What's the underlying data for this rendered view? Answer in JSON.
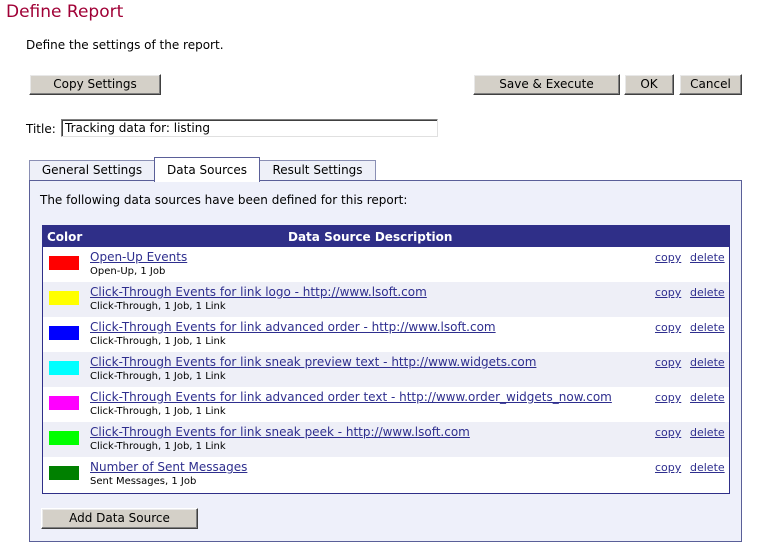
{
  "page": {
    "title": "Define Report",
    "intro": "Define the settings of the report."
  },
  "toolbar": {
    "copy_settings": "Copy Settings",
    "save_execute": "Save & Execute",
    "ok": "OK",
    "cancel": "Cancel"
  },
  "title_field": {
    "label": "Title:",
    "value": "Tracking data for: listing"
  },
  "tabs": [
    {
      "label": "General Settings",
      "active": false
    },
    {
      "label": "Data Sources",
      "active": true
    },
    {
      "label": "Result Settings",
      "active": false
    }
  ],
  "data_sources": {
    "intro": "The following data sources have been defined for this report:",
    "header_color": "Color",
    "header_description": "Data Source Description",
    "copy_label": "copy",
    "delete_label": "delete",
    "add_button": "Add Data Source",
    "rows": [
      {
        "color": "#ff0000",
        "name": "Open-Up Events",
        "detail": "Open-Up, 1 Job"
      },
      {
        "color": "#ffff00",
        "name": "Click-Through Events for link logo - http://www.lsoft.com",
        "detail": "Click-Through, 1 Job, 1 Link"
      },
      {
        "color": "#0000ff",
        "name": "Click-Through Events for link advanced order - http://www.lsoft.com",
        "detail": "Click-Through, 1 Job, 1 Link"
      },
      {
        "color": "#00ffff",
        "name": "Click-Through Events for link sneak preview text - http://www.widgets.com",
        "detail": "Click-Through, 1 Job, 1 Link"
      },
      {
        "color": "#ff00ff",
        "name": "Click-Through Events for link advanced order text - http://www.order_widgets_now.com",
        "detail": "Click-Through, 1 Job, 1 Link"
      },
      {
        "color": "#00ff00",
        "name": "Click-Through Events for link sneak peek - http://www.lsoft.com",
        "detail": "Click-Through, 1 Job, 1 Link"
      },
      {
        "color": "#008000",
        "name": "Number of Sent Messages",
        "detail": "Sent Messages, 1 Job"
      }
    ]
  }
}
